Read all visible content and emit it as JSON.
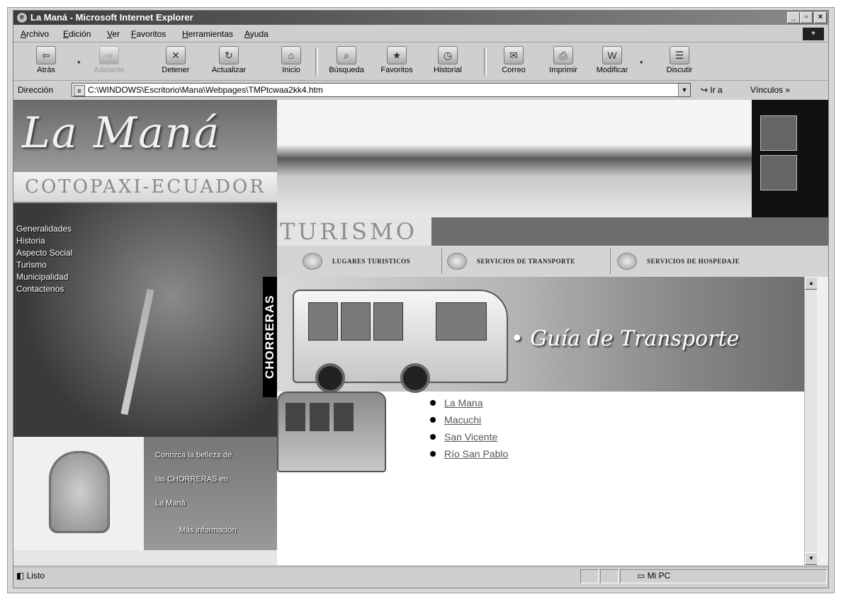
{
  "window": {
    "title": "La Maná - Microsoft Internet Explorer"
  },
  "menu": [
    "Archivo",
    "Edición",
    "Ver",
    "Favoritos",
    "Herramientas",
    "Ayuda"
  ],
  "toolbar": {
    "back": "Atrás",
    "forward": "Adelante",
    "stop": "Detener",
    "refresh": "Actualizar",
    "home": "Inicio",
    "search": "Búsqueda",
    "favorites": "Favoritos",
    "history": "Historial",
    "mail": "Correo",
    "print": "Imprimir",
    "edit": "Modificar",
    "discuss": "Discutir"
  },
  "address": {
    "label": "Dirección",
    "url": "C:\\WINDOWS\\Escritorio\\Mana\\Webpages\\TMPtcwaa2kk4.htm",
    "go": "Ir a",
    "links": "Vínculos"
  },
  "page": {
    "logo": "La Maná",
    "subtitle": "COTOPAXI-ECUADOR",
    "nav": [
      "Generalidades",
      "Historia",
      "Aspecto Social",
      "Turismo",
      "Municipalidad",
      "Contactenos"
    ],
    "vertical_label": "CHORRERAS",
    "promo": [
      "Conozca la belleza de",
      "las CHORRERAS en",
      "La Maná",
      "Más información"
    ],
    "section": "TURISMO",
    "tabs": [
      "LUGARES TURISTICOS",
      "SERVICIOS DE TRANSPORTE",
      "SERVICIOS DE HOSPEDAJE"
    ],
    "banner_title": "• Guía de Transporte",
    "links": [
      "La Mana",
      "Macuchi",
      "San Vicente",
      "Río San Pablo"
    ]
  },
  "status": {
    "text": "Listo",
    "zone": "Mi PC"
  }
}
